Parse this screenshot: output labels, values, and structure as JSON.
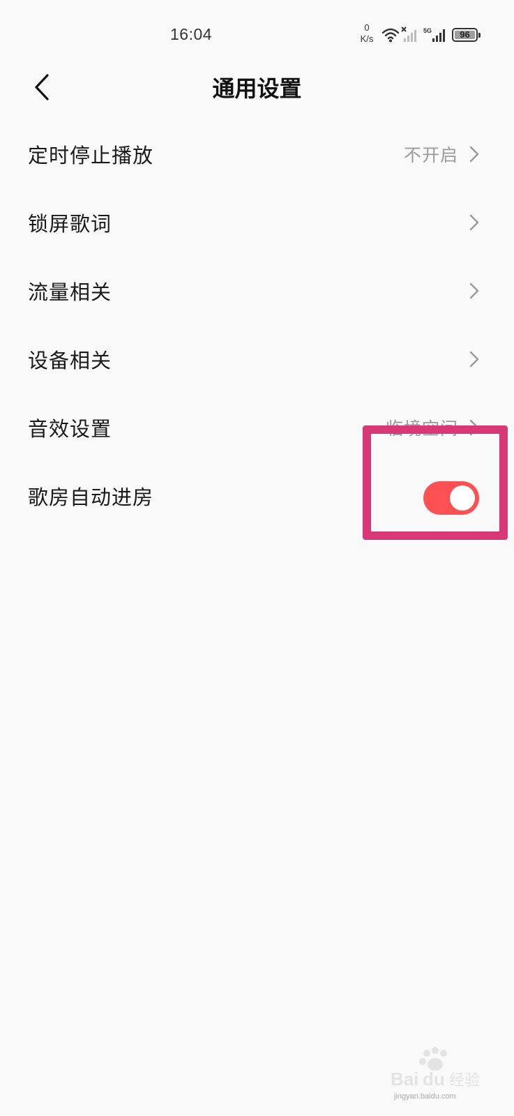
{
  "status_bar": {
    "time": "16:04",
    "net_speed_value": "0",
    "net_speed_unit": "K/s",
    "network_type": "5G",
    "battery_level": "96",
    "icons": [
      "wifi-icon",
      "signal-no-sim-icon",
      "signal-5g-icon",
      "battery-icon"
    ]
  },
  "header": {
    "title": "通用设置",
    "back_icon": "chevron-left-icon"
  },
  "settings": [
    {
      "label": "定时停止播放",
      "value": "不开启"
    },
    {
      "label": "锁屏歌词",
      "value": ""
    },
    {
      "label": "流量相关",
      "value": ""
    },
    {
      "label": "设备相关",
      "value": ""
    },
    {
      "label": "音效设置",
      "value": "临境空间"
    },
    {
      "label": "歌房自动进房",
      "toggle_on": true
    }
  ],
  "colors": {
    "toggle_on": "#fb5152",
    "highlight": "#d93877",
    "background": "#f9f9fa",
    "secondary_text": "#9a9a9a"
  },
  "watermark": {
    "brand": "Bai du 经验",
    "url": "jingyan.baidu.com"
  }
}
